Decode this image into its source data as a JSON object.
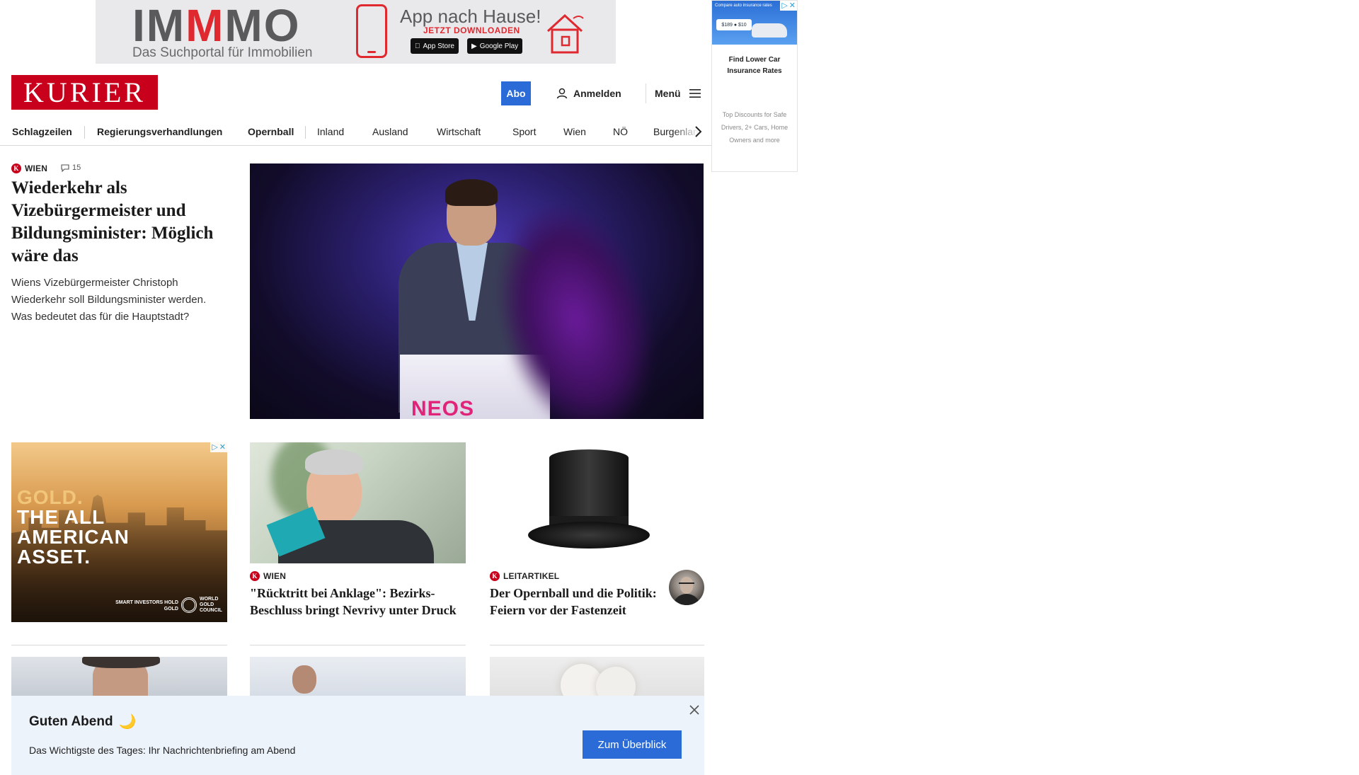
{
  "top_ad": {
    "brand_part1": "IM",
    "brand_part2": "M",
    "brand_part3": "MO",
    "tagline": "Das Suchportal für Immobilien",
    "headline": "App nach Hause!",
    "cta": "JETZT DOWNLOADEN",
    "store_apple": "App Store",
    "store_google": "Google Play"
  },
  "side_ad": {
    "image_caption": "Compare auto insurance rates",
    "price_label": "$189 ● $10",
    "title": "Find Lower Car Insurance Rates",
    "body": "Top Discounts for Safe Drivers, 2+ Cars, Home Owners and more"
  },
  "header": {
    "logo": "KURIER",
    "abo": "Abo",
    "login": "Anmelden",
    "menu": "Menü"
  },
  "nav": {
    "items": [
      "Schlagzeilen",
      "Regierungsverhandlungen",
      "Opernball",
      "Inland",
      "Ausland",
      "Wirtschaft",
      "Sport",
      "Wien",
      "NÖ",
      "Burgenland"
    ]
  },
  "lead": {
    "category": "WIEN",
    "comment_count": "15",
    "title": "Wiederkehr als Vizebürgermeister und Bildungsminister: Möglich wäre das",
    "teaser": "Wiens Vizebürgermeister Christoph Wiederkehr soll Bildungsminister werden. Was bedeutet das für die Hauptstadt?",
    "image_text": "NEOS"
  },
  "gold_ad": {
    "line1": "GOLD.",
    "line2": "THE ALL",
    "line3": "AMERICAN",
    "line4": "ASSET.",
    "claim": "SMART INVESTORS HOLD GOLD",
    "sponsor": "WORLD GOLD COUNCIL"
  },
  "cards": [
    {
      "category": "WIEN",
      "title": "\"Rücktritt bei Anklage\": Bezirks-Beschluss bringt Nevrivy unter Druck"
    },
    {
      "category": "LEITARTIKEL",
      "title": "Der Opernball und die Politik: Feiern vor der Fastenzeit"
    }
  ],
  "banner": {
    "greeting": "Guten Abend",
    "moon": "🌙",
    "description": "Das Wichtigste des Tages: Ihr Nachrichtenbriefing am Abend",
    "cta": "Zum Überblick"
  },
  "colors": {
    "brand_red": "#c8001b",
    "accent_blue": "#2b6bd7",
    "banner_bg": "#edf3fb"
  }
}
